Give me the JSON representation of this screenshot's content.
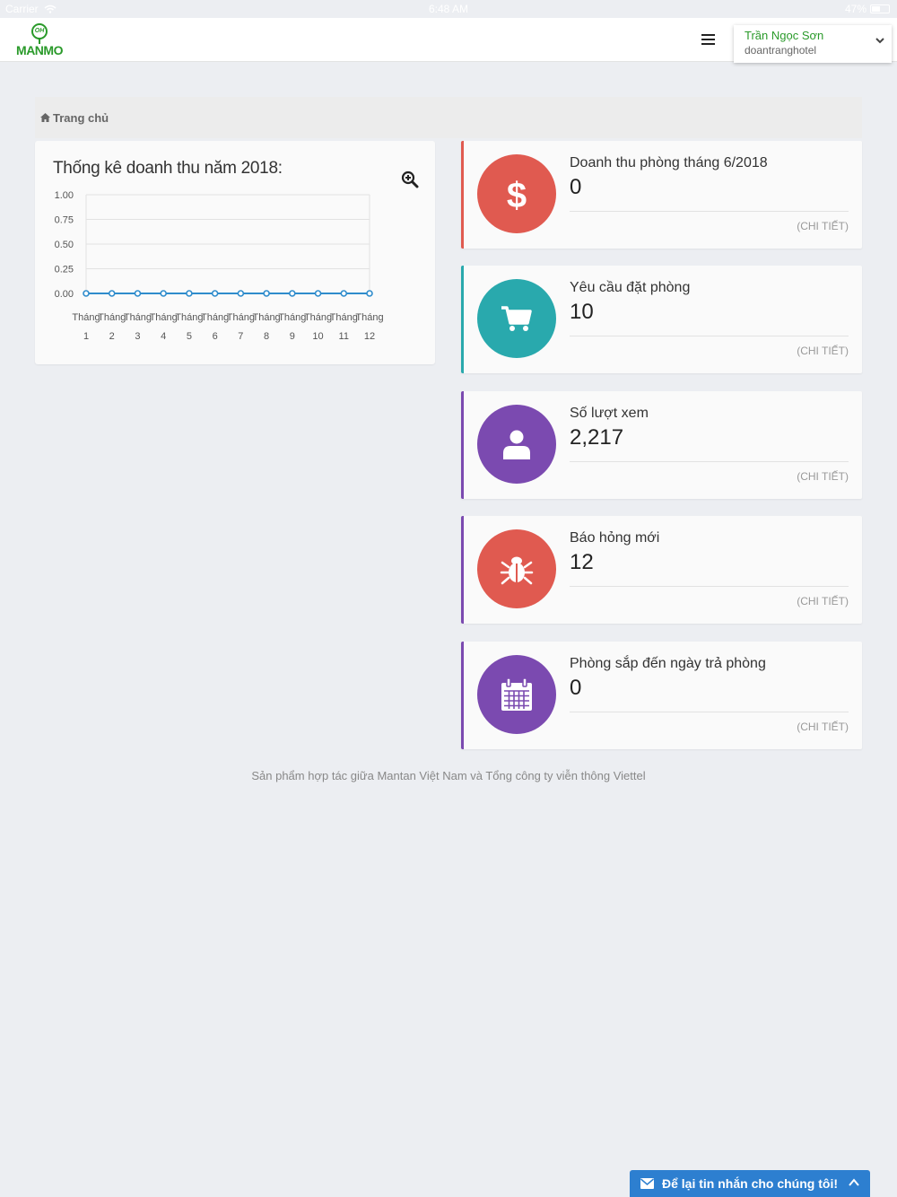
{
  "status_bar": {
    "carrier": "Carrier",
    "time": "6:48 AM",
    "battery": "47%"
  },
  "header": {
    "logo_text": "MANMO",
    "logo_mark": "OH",
    "user_name": "Trần Ngọc Sơn",
    "user_handle": "doantranghotel"
  },
  "breadcrumb": {
    "home_label": "Trang chủ"
  },
  "chart_card": {
    "title": "Thống kê doanh thu năm 2018:"
  },
  "chart_data": {
    "type": "line",
    "title": "Thống kê doanh thu năm 2018:",
    "categories": [
      "Tháng 1",
      "Tháng 2",
      "Tháng 3",
      "Tháng 4",
      "Tháng 5",
      "Tháng 6",
      "Tháng 7",
      "Tháng 8",
      "Tháng 9",
      "Tháng 10",
      "Tháng 11",
      "Tháng 12"
    ],
    "category_top": [
      "Tháng",
      "Tháng",
      "Tháng",
      "Tháng",
      "Tháng",
      "Tháng",
      "Tháng",
      "Tháng",
      "Tháng",
      "Tháng",
      "Tháng",
      "Tháng"
    ],
    "category_bottom": [
      "1",
      "2",
      "3",
      "4",
      "5",
      "6",
      "7",
      "8",
      "9",
      "10",
      "11",
      "12"
    ],
    "values": [
      0,
      0,
      0,
      0,
      0,
      0,
      0,
      0,
      0,
      0,
      0,
      0
    ],
    "ylim": [
      0,
      1
    ],
    "yticks": [
      "1.00",
      "0.75",
      "0.50",
      "0.25",
      "0.00"
    ],
    "grid": true,
    "line_color": "#2f8ccc"
  },
  "stats": [
    {
      "title": "Doanh thu phòng tháng 6/2018",
      "value": "0",
      "link": "(CHI TIẾT)",
      "color": "#e05a50",
      "border": "#e05a50",
      "icon": "dollar-icon"
    },
    {
      "title": "Yêu cầu đặt phòng",
      "value": "10",
      "link": "(CHI TIẾT)",
      "color": "#29a9ad",
      "border": "#29a9ad",
      "icon": "cart-icon"
    },
    {
      "title": "Số lượt xem",
      "value": "2,217",
      "link": "(CHI TIẾT)",
      "color": "#7b4ab0",
      "border": "#7b4ab0",
      "icon": "user-icon"
    },
    {
      "title": "Báo hỏng mới",
      "value": "12",
      "link": "(CHI TIẾT)",
      "color": "#e05a50",
      "border": "#7b4ab0",
      "icon": "bug-icon"
    },
    {
      "title": "Phòng sắp đến ngày trả phòng",
      "value": "0",
      "link": "(CHI TIẾT)",
      "color": "#7b4ab0",
      "border": "#7b4ab0",
      "icon": "calendar-icon"
    }
  ],
  "footer": {
    "text": "Sản phẩm hợp tác giữa Mantan Việt Nam và Tổng công ty viễn thông Viettel"
  },
  "chat": {
    "label": "Để lại tin nhắn cho chúng tôi!",
    "color": "#2d7fd0"
  }
}
